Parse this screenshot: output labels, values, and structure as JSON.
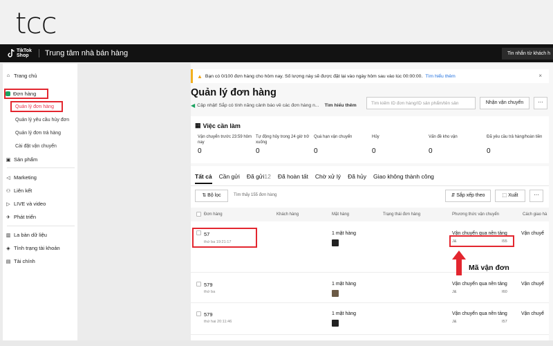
{
  "brand": {
    "logo": "tcc"
  },
  "topbar": {
    "app_name": "TikTok Shop",
    "title": "Trung tâm nhà bán hàng",
    "right_button": "Tin nhắn từ khách h"
  },
  "sidebar": {
    "home": "Trang chủ",
    "orders": "Đơn hàng",
    "order_subs": [
      "Quản lý đơn hàng",
      "Quản lý yêu cầu hủy đơn",
      "Quản lý đơn trả hàng",
      "Cài đặt vận chuyển"
    ],
    "products": "Sản phẩm",
    "marketing": "Marketing",
    "affiliate": "Liên kết",
    "live": "LIVE và video",
    "growth": "Phát triển",
    "data_compass": "La bàn dữ liệu",
    "account_health": "Tình trạng tài khoản",
    "finance": "Tài chính"
  },
  "notice": {
    "text": "Bạn có 0/100 đơn hàng cho hôm nay. Số lượng này sẽ được đặt lại vào ngày hôm sau vào lúc 00:00:00.",
    "link": "Tìm hiểu thêm",
    "close": "×"
  },
  "header": {
    "title": "Quản lý đơn hàng",
    "update_text": "Cập nhật! Sắp có tính năng cảnh báo về các đơn hàng n...",
    "update_link": "Tìm hiểu thêm",
    "search_placeholder": "Tìm kiếm ID đơn hàng/ID sản phẩm/tên sản",
    "ship_button": "Nhận vận chuyển",
    "more": "···"
  },
  "todo": {
    "title": "Việc cần làm",
    "cells": [
      {
        "label": "Vận chuyển trước 23:59 hôm nay",
        "value": "0"
      },
      {
        "label": "Tự động hủy trong 24 giờ trở xuống",
        "value": "0"
      },
      {
        "label": "Quá hạn vận chuyển",
        "value": "0"
      },
      {
        "label": "Hủy",
        "value": "0"
      },
      {
        "label": "Vấn đề kho vận",
        "value": "0"
      },
      {
        "label": "Đã yêu cầu trả hàng/hoàn tiền",
        "value": "0"
      }
    ]
  },
  "tabs": [
    {
      "label": "Tất cả",
      "count": ""
    },
    {
      "label": "Cần gửi",
      "count": ""
    },
    {
      "label": "Đã gửi",
      "count": "12"
    },
    {
      "label": "Đã hoàn tất",
      "count": ""
    },
    {
      "label": "Chờ xử lý",
      "count": ""
    },
    {
      "label": "Đã hủy",
      "count": ""
    },
    {
      "label": "Giao không thành công",
      "count": ""
    }
  ],
  "toolbar": {
    "filter": "Bộ lọc",
    "found": "Tìm thấy 155 đơn hàng",
    "sort": "Sắp xếp theo",
    "export": "Xuất",
    "more": "···"
  },
  "columns": [
    "Đơn hàng",
    "Khách hàng",
    "Mặt hàng",
    "Trạng thái đơn hàng",
    "Phương thức vận chuyển",
    "Cách giao hà"
  ],
  "rows": [
    {
      "order_id": "57",
      "time": "thứ ba 19:21:17",
      "items": "1 mặt hàng",
      "shipping": "Vận chuyển qua nền tảng",
      "carrier": "J&",
      "tracking": "I55",
      "shipping2": "Vận chuyể"
    },
    {
      "order_id": "579",
      "time": "thứ ba",
      "items": "1 mặt hàng",
      "shipping": "Vận chuyển qua nền tảng",
      "carrier": "J&",
      "tracking": "I60",
      "shipping2": "Vận chuyể"
    },
    {
      "order_id": "579",
      "time": "thứ hai 20:11:46",
      "items": "1 mặt hàng",
      "shipping": "Vận chuyển qua nền tảng",
      "carrier": "J&",
      "tracking": "I57",
      "shipping2": "Vận chuyể"
    }
  ],
  "annotation": {
    "label": "Mã vận đơn",
    "color": "#e3262f"
  }
}
